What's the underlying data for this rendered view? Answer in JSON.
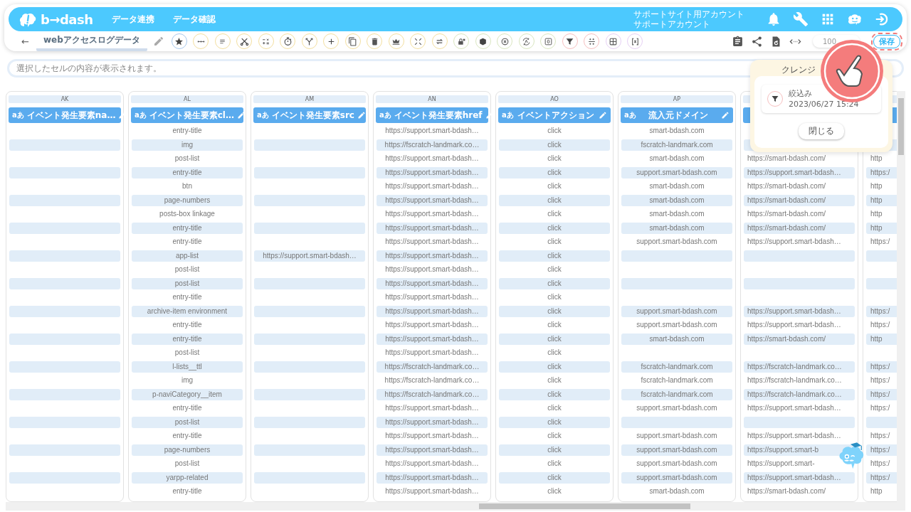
{
  "header": {
    "logo": "b→dash",
    "nav": [
      {
        "label": "データ連携"
      },
      {
        "label": "データ確認"
      }
    ],
    "account": [
      "サポートサイト用アカウント",
      "サポートアカウント"
    ]
  },
  "toolbar": {
    "back": "←",
    "title": "webアクセスログデータ",
    "zoom": "100",
    "save": "保存"
  },
  "cell_bar": {
    "placeholder": "選択したセルの内容が表示されます。"
  },
  "grid": {
    "columns": [
      {
        "letter": "AK",
        "type": "aあ",
        "name": "イベント発生要素na…",
        "cells": [
          null,
          null,
          null,
          null,
          null,
          null,
          null,
          null,
          null,
          null,
          null,
          null,
          null,
          null,
          null,
          null,
          null,
          null,
          null,
          null,
          null,
          null,
          null,
          null,
          null,
          null,
          null
        ]
      },
      {
        "letter": "AL",
        "type": "aあ",
        "name": "イベント発生要素cl…",
        "cells": [
          "entry-title",
          "img",
          "post-list",
          "entry-title",
          "btn",
          "page-numbers",
          "posts-box linkage",
          "entry-title",
          "entry-title",
          "app-list",
          "post-list",
          "post-list",
          "entry-title",
          "archive-item environment",
          "entry-title",
          "entry-title",
          "post-list",
          "l-lists__ttl",
          "img",
          "p-naviCategory__item",
          "entry-title",
          "post-list",
          "entry-title",
          "page-numbers",
          "post-list",
          "yarpp-related",
          "entry-title"
        ]
      },
      {
        "letter": "AM",
        "type": "aあ",
        "name": "イベント発生要素src",
        "cells": [
          null,
          null,
          null,
          null,
          null,
          null,
          null,
          null,
          null,
          "https://support.smart-bdash…",
          null,
          null,
          null,
          null,
          null,
          null,
          null,
          null,
          null,
          null,
          null,
          null,
          null,
          null,
          null,
          null,
          null
        ]
      },
      {
        "letter": "AN",
        "type": "aあ",
        "name": "イベント発生要素href",
        "cells": [
          "https://support.smart-bdash…",
          "https://fscratch-landmark.co…",
          "https://support.smart-bdash…",
          "https://support.smart-bdash…",
          "https://support.smart-bdash…",
          "https://support.smart-bdash…",
          "https://support.smart-bdash…",
          "https://support.smart-bdash…",
          "https://support.smart-bdash…",
          "https://support.smart-bdash…",
          "https://support.smart-bdash…",
          "https://support.smart-bdash…",
          "https://support.smart-bdash…",
          "https://support.smart-bdash…",
          "https://support.smart-bdash…",
          "https://support.smart-bdash…",
          "https://support.smart-bdash…",
          "https://fscratch-landmark.co…",
          "https://fscratch-landmark.co…",
          "https://fscratch-landmark.co…",
          "https://support.smart-bdash…",
          "https://support.smart-bdash…",
          "https://support.smart-bdash…",
          "https://support.smart-bdash…",
          "https://support.smart-bdash…",
          "https://support.smart-bdash…",
          "https://support.smart-bdash…"
        ]
      },
      {
        "letter": "AO",
        "type": "aあ",
        "name": "イベントアクション",
        "cells": [
          "click",
          "click",
          "click",
          "click",
          "click",
          "click",
          "click",
          "click",
          "click",
          "click",
          "click",
          "click",
          "click",
          "click",
          "click",
          "click",
          "click",
          "click",
          "click",
          "click",
          "click",
          "click",
          "click",
          "click",
          "click",
          "click",
          "click"
        ]
      },
      {
        "letter": "AP",
        "type": "aあ",
        "name": "流入元ドメイン",
        "cells": [
          "smart-bdash.com",
          "fscratch-landmark.com",
          "smart-bdash.com",
          "support.smart-bdash.com",
          "smart-bdash.com",
          "smart-bdash.com",
          "smart-bdash.com",
          "smart-bdash.com",
          "support.smart-bdash.com",
          null,
          null,
          null,
          null,
          "support.smart-bdash.com",
          "support.smart-bdash.com",
          "smart-bdash.com",
          null,
          "fscratch-landmark.com",
          "fscratch-landmark.com",
          "fscratch-landmark.com",
          "support.smart-bdash.com",
          null,
          "support.smart-bdash.com",
          "support.smart-bdash.com",
          "support.smart-bdash.com",
          "support.smart-bdash.com",
          "smart-bdash.com"
        ]
      },
      {
        "cells": [
          null,
          null,
          "https://smart-bdash.com/",
          "https://support.smart-bdash…",
          "https://smart-bdash.com/",
          "https://smart-bdash.com/",
          "https://smart-bdash.com/",
          "https://smart-bdash.com/",
          "https://support.smart-bdash…",
          null,
          null,
          null,
          null,
          "https://support.smart-bdash…",
          "https://support.smart-bdash…",
          "https://smart-bdash.com/",
          null,
          "https://fscratch-landmark.co…",
          "https://fscratch-landmark.co…",
          "https://fscratch-landmark.co…",
          "https://support.smart-bdash…",
          null,
          "https://support.smart-bdash…",
          "https://support.smart-b",
          "https://support.smart-",
          "https://support.smart-bdash…",
          "https://smart-bdash.com/"
        ]
      },
      {
        "cells": [
          null,
          null,
          "http",
          "https:/",
          "http",
          "http",
          "http",
          "http",
          "https:/",
          null,
          null,
          null,
          null,
          "https:/",
          "https:/",
          "http",
          null,
          "https:/",
          "https:/",
          "https:/",
          "https:/",
          null,
          "https:/",
          "https:/",
          "https:/",
          "https:/",
          "http"
        ]
      }
    ]
  },
  "popup": {
    "title": "クレンジ",
    "entries": [
      {
        "label": "絞込み",
        "time": "2023/06/27 15:24"
      }
    ],
    "close": "閉じる"
  }
}
